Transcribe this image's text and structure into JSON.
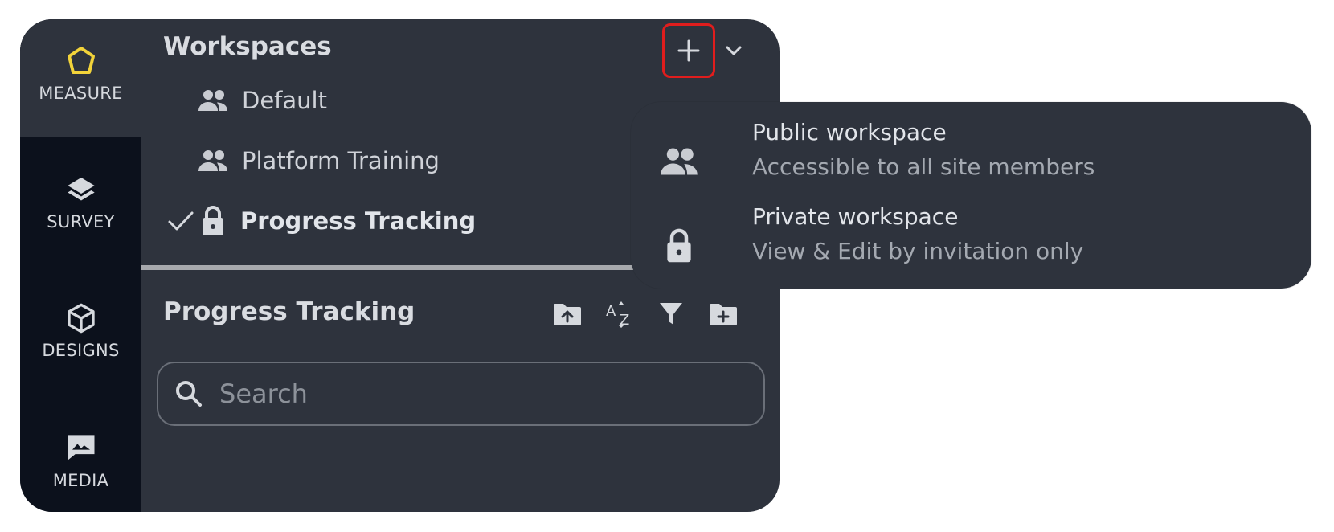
{
  "colors": {
    "panel_bg": "#2e333d",
    "rail_bg": "#0c111c",
    "accent_yellow": "#f2d33a",
    "highlight_red": "#e01d1d"
  },
  "rail": {
    "items": [
      {
        "label": "MEASURE",
        "icon": "pentagon-icon",
        "active": true
      },
      {
        "label": "SURVEY",
        "icon": "layers-icon",
        "active": false
      },
      {
        "label": "DESIGNS",
        "icon": "cube-icon",
        "active": false
      },
      {
        "label": "MEDIA",
        "icon": "image-icon",
        "active": false
      }
    ]
  },
  "workspaces": {
    "title": "Workspaces",
    "add_icon": "plus-icon",
    "collapse_icon": "chevron-down-icon",
    "items": [
      {
        "label": "Default",
        "icon": "group-icon",
        "selected": false
      },
      {
        "label": "Platform Training",
        "icon": "group-icon",
        "selected": false
      },
      {
        "label": "Progress Tracking",
        "icon": "lock-icon",
        "selected": true
      }
    ]
  },
  "current": {
    "title": "Progress Tracking",
    "tools": [
      "folder-upload-icon",
      "sort-az-icon",
      "filter-icon",
      "folder-add-icon"
    ]
  },
  "search": {
    "placeholder": "Search",
    "value": ""
  },
  "menu": {
    "options": [
      {
        "title": "Public workspace",
        "subtitle": "Accessible to all site members",
        "icon": "group-icon"
      },
      {
        "title": "Private workspace",
        "subtitle": "View & Edit by invitation only",
        "icon": "lock-icon"
      }
    ]
  }
}
